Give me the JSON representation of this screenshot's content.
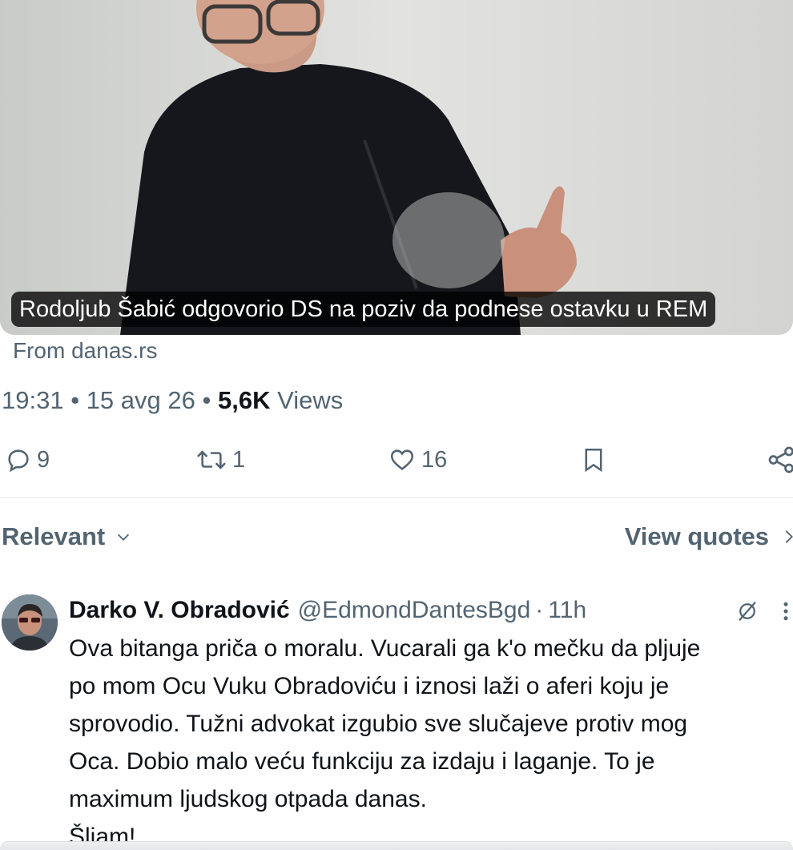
{
  "media": {
    "caption": "Rodoljub Šabić odgovorio DS na poziv da podnese ostavku u REM",
    "source": "From danas.rs"
  },
  "post_meta": {
    "time": "19:31",
    "separator": "•",
    "date": "15 avg 26",
    "views_count": "5,6K",
    "views_label": "Views"
  },
  "actions": {
    "replies": "9",
    "reposts": "1",
    "likes": "16"
  },
  "sort": {
    "label": "Relevant",
    "view_quotes": "View quotes"
  },
  "reply": {
    "name": "Darko V. Obradović",
    "handle": "@EdmondDantesBgd",
    "separator": "·",
    "time": "11h",
    "lines": [
      "Ova bitanga priča o moralu. Vucarali ga k'o mečku da pljuje",
      "po mom Ocu Vuku Obradoviću i iznosi laži o aferi koju je",
      "sprovodio. Tužni advokat izgubio sve slučajeve protiv mog",
      "Oca. Dobio malo veću funkciju za izdaju i laganje. To je",
      "maximum ljudskog otpada danas.",
      "Šljam!"
    ]
  },
  "icons": {
    "reply": "reply-icon",
    "repost": "repost-icon",
    "like": "heart-icon",
    "bookmark": "bookmark-icon",
    "share": "share-icon",
    "chevron": "chevron-down-icon",
    "arrow": "chevron-right-icon",
    "grok": "grok-icon",
    "more": "more-icon"
  },
  "colors": {
    "secondary_text": "#536471",
    "primary_text": "#0f1419",
    "divider": "#e6e9eb"
  }
}
